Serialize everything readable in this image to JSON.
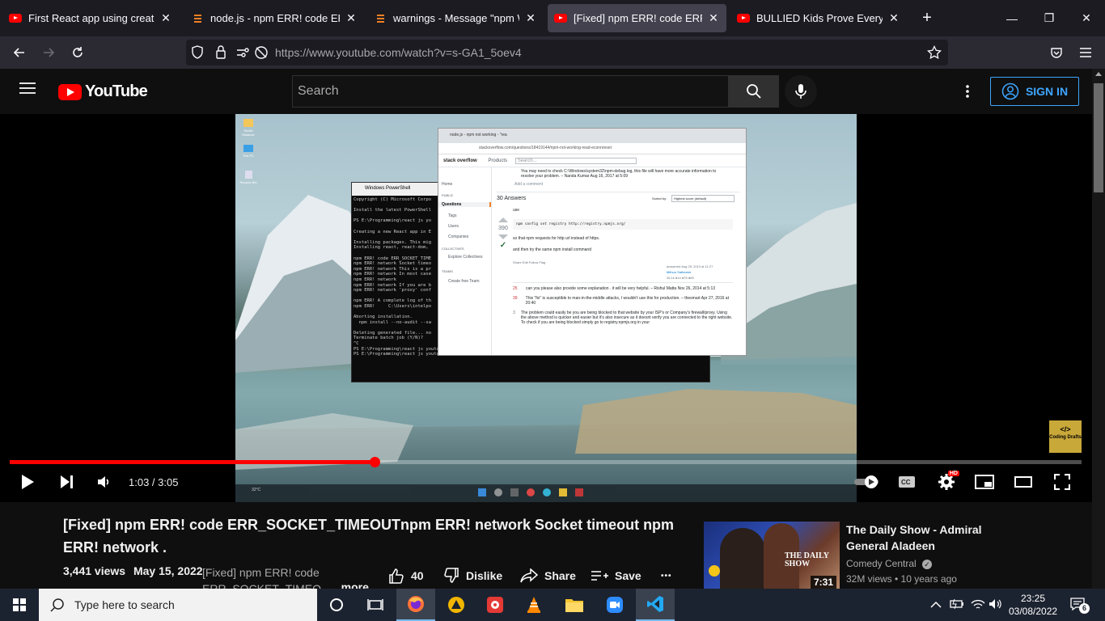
{
  "browser": {
    "tabs": [
      {
        "label": "First React app using create-rea",
        "favicon": "youtube-icon",
        "active": false
      },
      {
        "label": "node.js - npm ERR! code ERR_SO",
        "favicon": "stackoverflow-icon",
        "active": false
      },
      {
        "label": "warnings - Message \"npm WAR",
        "favicon": "stackoverflow-icon",
        "active": false
      },
      {
        "label": "[Fixed] npm ERR! code ERR_SOC",
        "favicon": "youtube-icon",
        "active": true
      },
      {
        "label": "BULLIED Kids Prove Everyone W",
        "favicon": "youtube-icon",
        "active": false
      }
    ],
    "url": "https://www.youtube.com/watch?v=s-GA1_5oev4",
    "new_tab": "+",
    "close_glyph": "✕",
    "window_controls": [
      "—",
      "❐",
      "✕"
    ]
  },
  "youtube": {
    "logo_text": "YouTube",
    "search_placeholder": "Search",
    "sign_in": "SIGN IN",
    "accent": "#3ea6ff",
    "brand_red": "#ff0000"
  },
  "player": {
    "time": "1:03 / 3:05",
    "progress": 0.3405,
    "hd_badge": "HD",
    "watermark": "Coding Drafts",
    "watermark_glyph": "</>"
  },
  "embedded": {
    "desktop_icons": [
      "Shubh Walance",
      "This PC",
      "Recycle Bin"
    ],
    "powershell": {
      "title": "Windows PowerShell",
      "lines": [
        "Copyright (C) Microsoft Corpo",
        "",
        "Install the latest PowerShell",
        "",
        "PS E:\\Programming\\react js yo",
        "",
        "Creating a new React app in E",
        "",
        "Installing packages. This mig",
        "Installing react, react-dom,",
        "",
        "npm ERR! code ERR_SOCKET_TIME",
        "npm ERR! network Socket timeo",
        "npm ERR! network This is a pr",
        "npm ERR! network In most case",
        "npm ERR! network",
        "npm ERR! network If you are b",
        "npm ERR! network 'proxy' conf",
        "",
        "npm ERR! A complete log of th",
        "npm ERR!     C:\\Users\\intelpo",
        "",
        "Aborting installation.",
        "  npm install --no-audit --sa",
        "",
        "Deleting generated file... no",
        "Terminate batch job (Y/N)?",
        "^C",
        "PS E:\\Programming\\react js youtube> npm config set registry http://registry.npmjs.org/",
        "PS E:\\Programming\\react js youtube>"
      ]
    },
    "so": {
      "tab": "node.js - npm not working - \"rea",
      "url": "stackoverflow.com/questions/18419144/npm-not-working-read-econnreset",
      "brand": "stack overflow",
      "nav_products": "Products",
      "search": "Search...",
      "sidebar": [
        "Home",
        "PUBLIC",
        "Questions",
        "Tags",
        "Users",
        "Companies",
        "COLLECTIVES",
        "Explore Collectives",
        "TEAMS",
        "Create free Team"
      ],
      "answers_count": "30 Answers",
      "sorted_by": "Sorted by:",
      "sort_value": "Highest score (default)",
      "votes": "390",
      "top_comment": "You may need to check C:\\Windows\\system32\\npm-debug.log, this file will have more accurate information to resolve your problem. – Nanda Kumar Aug 16, 2017 at 5:09",
      "add_comment": "Add a comment",
      "use": "use",
      "code": "npm config set registry http://registry.npmjs.org/",
      "p1": "so that npm requests for http url instead of https.",
      "p2": "and then try the same npm install command",
      "links": "Share  Edit  Follow  Flag",
      "answered": "answered Aug 25, 2013 at 11:27",
      "author": "Mithun Satheesh",
      "rep": "26.1k ●14 ●76 ●89",
      "comments": [
        {
          "score": "25",
          "text": "can you please also provide some explanation . it will be very helpful. – Rishul Matta Nov 26, 2014 at 5:13"
        },
        {
          "score": "39",
          "text": "This \"fix\" is susceptible to man-in-the-middle attacks, I wouldn't use this for production. – thesmart Apr 27, 2016 at 20:40"
        },
        {
          "score": "3",
          "text": "The problem could easily be you are being blocked to that website by your ISP's or Company's firewall/proxy. Using the above method is quicker and easier but it's also insecure as it doesnt verify you are connected to the right website. To check if you are being blocked simply go to registry.npmjs.org in your"
        }
      ]
    },
    "taskbar_weather": "32°C"
  },
  "video": {
    "title": "[Fixed] npm ERR! code ERR_SOCKET_TIMEOUTnpm ERR! network Socket timeout npm ERR! network .",
    "views": "3,441 views",
    "date": "May 15, 2022",
    "description": "[Fixed] npm ERR! code ERR_SOCKET_TIMEOUTnpm ERR! network Socket timeout npm ERR! network .",
    "more": "...more",
    "likes": "40",
    "dislike": "Dislike",
    "share": "Share",
    "save": "Save",
    "overflow": "•••"
  },
  "related": {
    "title": "The Daily Show - Admiral General Aladeen",
    "channel": "Comedy Central",
    "stats": "32M views • 10 years ago",
    "duration": "7:31",
    "thumb_text": "THE DAILY SHOW"
  },
  "taskbar": {
    "search_placeholder": "Type here to search",
    "time": "23:25",
    "date": "03/08/2022",
    "notification_count": "6"
  }
}
